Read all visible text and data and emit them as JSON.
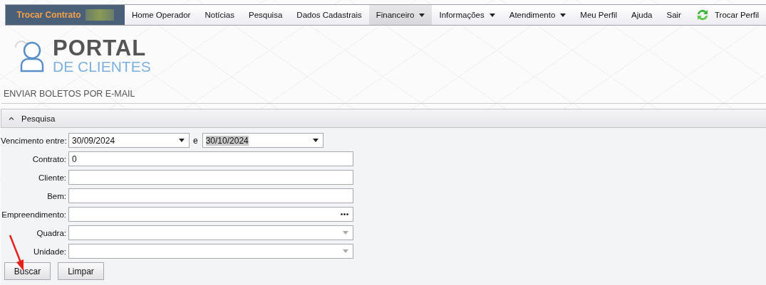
{
  "nav": {
    "brand": "Trocar Contrato",
    "items": [
      {
        "label": "Home Operador",
        "selected": false,
        "dropdown": false
      },
      {
        "label": "Notícias",
        "selected": false,
        "dropdown": false
      },
      {
        "label": "Pesquisa",
        "selected": false,
        "dropdown": false
      },
      {
        "label": "Dados Cadastrais",
        "selected": false,
        "dropdown": false
      },
      {
        "label": "Financeiro",
        "selected": true,
        "dropdown": true
      },
      {
        "label": "Informações",
        "selected": false,
        "dropdown": true
      },
      {
        "label": "Atendimento",
        "selected": false,
        "dropdown": true
      },
      {
        "label": "Meu Perfil",
        "selected": false,
        "dropdown": false
      },
      {
        "label": "Ajuda",
        "selected": false,
        "dropdown": false
      },
      {
        "label": "Sair",
        "selected": false,
        "dropdown": false
      }
    ],
    "switch_profile": "Trocar Perfil"
  },
  "logo": {
    "title": "PORTAL",
    "subtitle": "DE CLIENTES"
  },
  "page_title": "ENVIAR BOLETOS POR E-MAIL",
  "panel": {
    "title": "Pesquisa",
    "expanded": true,
    "fields": [
      {
        "kind": "date_range",
        "label": "Vencimento entre:",
        "from": "30/09/2024",
        "separator": "e",
        "to": "30/10/2024",
        "to_highlighted": true
      },
      {
        "kind": "text",
        "label": "Contrato:",
        "value": "0"
      },
      {
        "kind": "text",
        "label": "Cliente:"
      },
      {
        "kind": "text",
        "label": "Bem:"
      },
      {
        "kind": "lookup",
        "label": "Empreendimento:"
      },
      {
        "kind": "select",
        "label": "Quadra:"
      },
      {
        "kind": "select",
        "label": "Unidade:"
      }
    ]
  },
  "buttons": [
    "Buscar",
    "Limpar"
  ]
}
